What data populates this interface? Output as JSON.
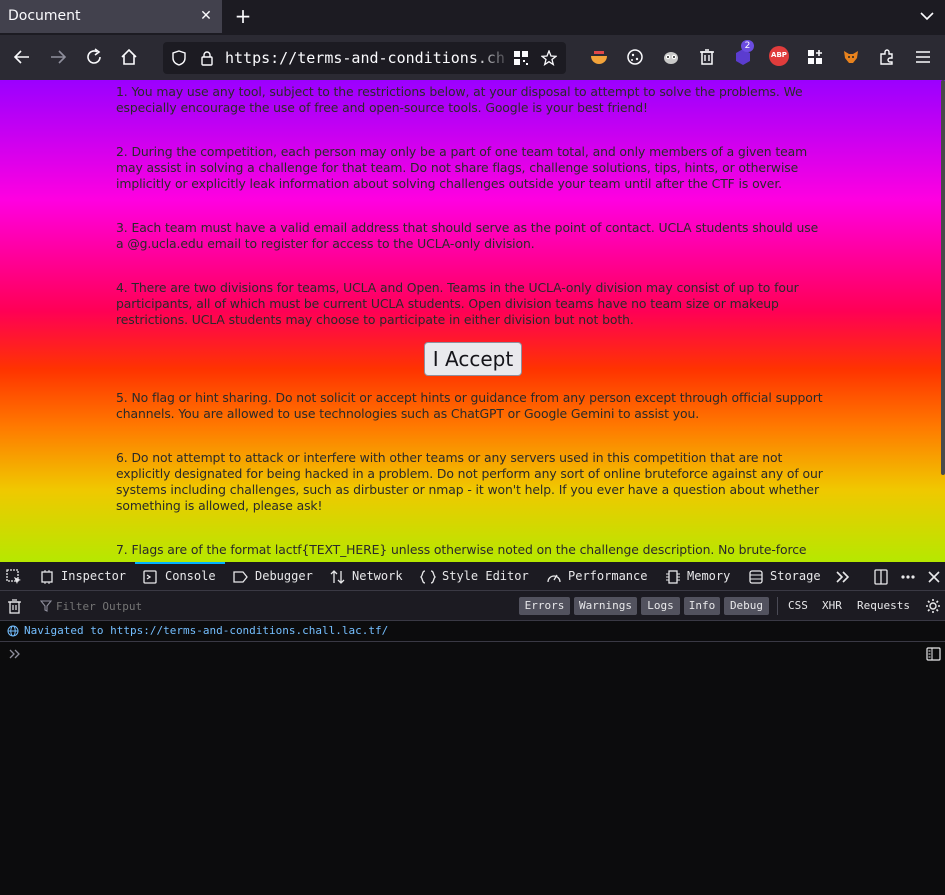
{
  "browser": {
    "tab_title": "Document",
    "url": "https://terms-and-conditions.chall.lac.tf/",
    "badge_count": "2",
    "abp_label": "ABP"
  },
  "page": {
    "rules": [
      "1. You may use any tool, subject to the restrictions below, at your disposal to attempt to solve the problems. We especially encourage the use of free and open-source tools. Google is your best friend!",
      "2. During the competition, each person may only be a part of one team total, and only members of a given team may assist in solving a challenge for that team. Do not share flags, challenge solutions, tips, hints, or otherwise implicitly or explicitly leak information about solving challenges outside your team until after the CTF is over.",
      "3. Each team must have a valid email address that should serve as the point of contact. UCLA students should use a @g.ucla.edu email to register for access to the UCLA-only division.",
      "4. There are two divisions for teams, UCLA and Open. Teams in the UCLA-only division may consist of up to four participants, all of which must be current UCLA students. Open division teams have no team size or makeup restrictions. UCLA students may choose to participate in either division but not both.",
      "5. No flag or hint sharing. Do not solicit or accept hints or guidance from any person except through official support channels. You are allowed to use technologies such as ChatGPT or Google Gemini to assist you.",
      "6. Do not attempt to attack or interfere with other teams or any servers used in this competition that are not explicitly designated for being hacked in a problem. Do not perform any sort of online bruteforce against any of our systems including challenges, such as dirbuster or nmap - it won't help. If you ever have a question about whether something is allowed, please ask!",
      "7. Flags are of the format lactf{TEXT_HERE} unless otherwise noted on the challenge description. No brute-force"
    ],
    "accept_button": "I Accept"
  },
  "devtools": {
    "tabs": [
      "Inspector",
      "Console",
      "Debugger",
      "Network",
      "Style Editor",
      "Performance",
      "Memory",
      "Storage"
    ],
    "active_tab": "Console",
    "filter_placeholder": "Filter Output",
    "levels": [
      "Errors",
      "Warnings",
      "Logs",
      "Info",
      "Debug"
    ],
    "net_filters": [
      "CSS",
      "XHR",
      "Requests"
    ],
    "navigated_label": "Navigated to",
    "navigated_url": "https://terms-and-conditions.chall.lac.tf/"
  },
  "colors": {
    "accent": "#00b2ff",
    "link": "#75bfff",
    "toolbar_bg": "#2b2a33",
    "devtools_bg": "#0c0c0d"
  }
}
